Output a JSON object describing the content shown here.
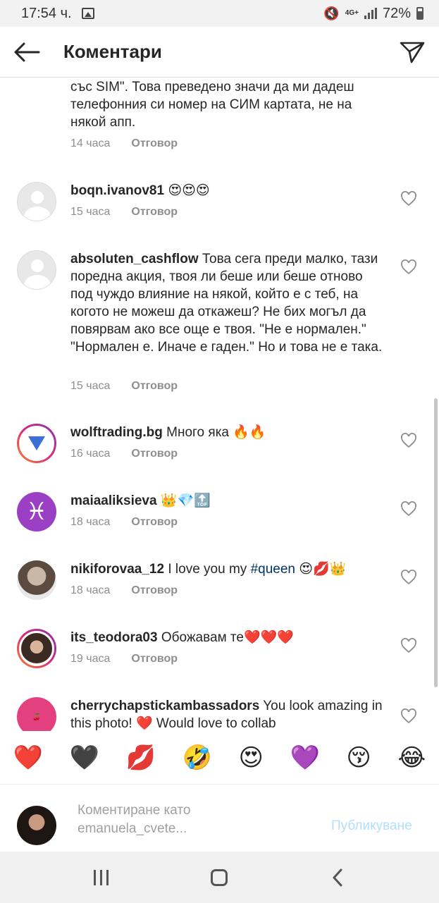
{
  "status_bar": {
    "time": "17:54 ч.",
    "network": "4G+",
    "battery": "72%"
  },
  "header": {
    "title": "Коментари"
  },
  "comments": [
    {
      "username": "",
      "text": "със SIM\". Това преведено значи да ми дадеш телефонния си номер на СИМ картата, не на някой апп.",
      "time": "14 часа",
      "reply": "Отговор"
    },
    {
      "username": "boqn.ivanov81",
      "text": "😍😍😍",
      "time": "15 часа",
      "reply": "Отговор"
    },
    {
      "username": "absoluten_cashflow",
      "text": "Това сега преди малко, тази поредна акция, твоя ли беше или беше отново под чуждо влияние на някой, който е с теб, на когото не можеш да откажеш? Не бих могъл да повярвам ако все още е твоя. \"Не е нормален.\" \"Нормален е. Иначе е гаден.\" Но и това не е така.",
      "time": "15 часа",
      "reply": "Отговор"
    },
    {
      "username": "wolftrading.bg",
      "text": "Много яка 🔥🔥",
      "time": "16 часа",
      "reply": "Отговор"
    },
    {
      "username": "maiaaliksieva",
      "text": "👑💎🔝",
      "time": "18 часа",
      "reply": "Отговор"
    },
    {
      "username": "nikiforovaa_12",
      "text_before": "I love you my ",
      "hashtag": "#queen",
      "text_after": " 😍💋👑",
      "time": "18 часа",
      "reply": "Отговор"
    },
    {
      "username": "its_teodora03",
      "text": "Обожавам те❤️❤️❤️",
      "time": "19 часа",
      "reply": "Отговор"
    },
    {
      "username": "cherrychapstickambassadors",
      "text": "You look amazing in this photo! ❤️ Would love to collab",
      "time": "",
      "reply": ""
    }
  ],
  "emoji_bar": [
    "❤️",
    "🖤",
    "💋",
    "🤣",
    "😍",
    "💜",
    "😚",
    "😂"
  ],
  "composer": {
    "placeholder_line1": "Коментиране като",
    "placeholder_line2": "emanuela_cvete...",
    "post_label": "Публикуване"
  },
  "icons": {
    "back": "arrow-left-icon",
    "share": "paper-plane-icon",
    "like": "heart-outline-icon"
  },
  "colors": {
    "link": "#003569",
    "post_button": "#b2dffc",
    "meta_text": "#8e8e8e"
  }
}
